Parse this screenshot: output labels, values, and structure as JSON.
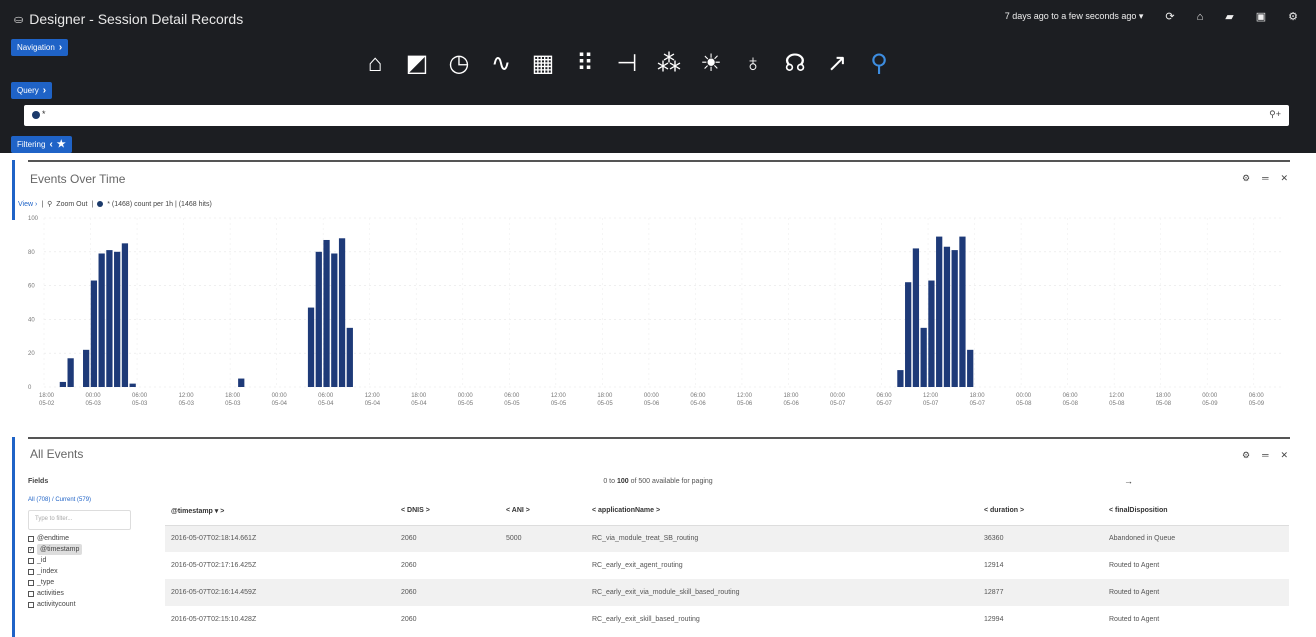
{
  "app": {
    "title": "Designer - Session Detail Records"
  },
  "topright": {
    "time_range": "7 days ago to a few seconds ago ▾"
  },
  "pills": {
    "navigation": "Navigation",
    "query": "Query",
    "filtering": "Filtering"
  },
  "nav_icons": [
    "home-icon",
    "chart-icon",
    "history-icon",
    "pulse-icon",
    "calendar-icon",
    "grid-icon",
    "flow-icon",
    "network-icon",
    "sun-icon",
    "microphone-icon",
    "agent-icon",
    "arrow-icon",
    "search-icon"
  ],
  "query": {
    "value": "*"
  },
  "events_over_time": {
    "title": "Events Over Time",
    "view_label": "View",
    "zoom_label": "Zoom Out",
    "legend_text": "* (1468)  count per 1h | (1468 hits)"
  },
  "chart_data": {
    "type": "bar",
    "ylim": [
      0,
      100
    ],
    "yticks": [
      0,
      20,
      40,
      60,
      80,
      100
    ],
    "grid": true,
    "xtick_labels": [
      [
        "18:00",
        "05-02"
      ],
      [
        "00:00",
        "05-03"
      ],
      [
        "06:00",
        "05-03"
      ],
      [
        "12:00",
        "05-03"
      ],
      [
        "18:00",
        "05-03"
      ],
      [
        "00:00",
        "05-04"
      ],
      [
        "06:00",
        "05-04"
      ],
      [
        "12:00",
        "05-04"
      ],
      [
        "18:00",
        "05-04"
      ],
      [
        "00:00",
        "05-05"
      ],
      [
        "06:00",
        "05-05"
      ],
      [
        "12:00",
        "05-05"
      ],
      [
        "18:00",
        "05-05"
      ],
      [
        "00:00",
        "05-06"
      ],
      [
        "06:00",
        "05-06"
      ],
      [
        "12:00",
        "05-06"
      ],
      [
        "18:00",
        "05-06"
      ],
      [
        "00:00",
        "05-07"
      ],
      [
        "06:00",
        "05-07"
      ],
      [
        "12:00",
        "05-07"
      ],
      [
        "18:00",
        "05-07"
      ],
      [
        "00:00",
        "05-08"
      ],
      [
        "06:00",
        "05-08"
      ],
      [
        "12:00",
        "05-08"
      ],
      [
        "18:00",
        "05-08"
      ],
      [
        "00:00",
        "05-09"
      ],
      [
        "06:00",
        "05-09"
      ]
    ],
    "values": [
      0,
      3,
      17,
      0,
      22,
      63,
      79,
      81,
      80,
      85,
      2,
      0,
      0,
      0,
      0,
      0,
      0,
      0,
      0,
      0,
      0,
      0,
      0,
      0,
      5,
      0,
      0,
      0,
      0,
      0,
      0,
      0,
      0,
      47,
      80,
      87,
      79,
      88,
      35,
      0,
      0,
      0,
      0,
      0,
      0,
      0,
      0,
      0,
      0,
      0,
      0,
      0,
      0,
      0,
      0,
      0,
      0,
      0,
      0,
      0,
      0,
      0,
      0,
      0,
      0,
      0,
      0,
      0,
      0,
      0,
      0,
      0,
      0,
      0,
      0,
      0,
      0,
      0,
      0,
      0,
      0,
      0,
      0,
      0,
      0,
      0,
      0,
      0,
      0,
      0,
      0,
      0,
      0,
      0,
      0,
      0,
      0,
      0,
      0,
      0,
      0,
      0,
      0,
      0,
      0,
      0,
      0,
      0,
      0,
      10,
      62,
      82,
      35,
      63,
      89,
      83,
      81,
      89,
      22,
      0,
      0,
      0,
      0,
      0,
      0,
      0,
      0,
      0,
      0,
      0,
      0,
      0,
      0,
      0,
      0,
      0,
      0,
      0,
      0,
      0,
      0,
      0,
      0,
      0,
      0,
      0,
      0,
      0,
      0,
      0,
      0,
      0,
      0,
      0,
      0,
      0,
      0,
      0,
      0,
      0,
      0,
      0,
      0,
      0,
      0,
      0
    ]
  },
  "all_events": {
    "title": "All Events",
    "fields_title": "Fields",
    "fields_toggle": "All (708) / Current (579)",
    "filter_placeholder": "Type to filter...",
    "paging_prefix": "0 to ",
    "paging_count": "100",
    "paging_suffix": " of 500 available for paging",
    "fields": [
      {
        "label": "@endtime",
        "checked": false
      },
      {
        "label": "@timestamp",
        "checked": true
      },
      {
        "label": "_id",
        "checked": false
      },
      {
        "label": "_index",
        "checked": false
      },
      {
        "label": "_type",
        "checked": false
      },
      {
        "label": "activities",
        "checked": false
      },
      {
        "label": "activitycount",
        "checked": false
      }
    ],
    "columns": [
      "@timestamp ▾ >",
      "< DNIS >",
      "< ANI >",
      "< applicationName >",
      "< duration >",
      "< finalDisposition"
    ],
    "rows": [
      [
        "2016-05-07T02:18:14.661Z",
        "2060",
        "5000",
        "RC_via_module_treat_SB_routing",
        "36360",
        "Abandoned in Queue"
      ],
      [
        "2016-05-07T02:17:16.425Z",
        "2060",
        "",
        "RC_early_exit_agent_routing",
        "12914",
        "Routed to Agent"
      ],
      [
        "2016-05-07T02:16:14.459Z",
        "2060",
        "",
        "RC_early_exit_via_module_skill_based_routing",
        "12877",
        "Routed to Agent"
      ],
      [
        "2016-05-07T02:15:10.428Z",
        "2060",
        "",
        "RC_early_exit_skill_based_routing",
        "12994",
        "Routed to Agent"
      ]
    ]
  }
}
